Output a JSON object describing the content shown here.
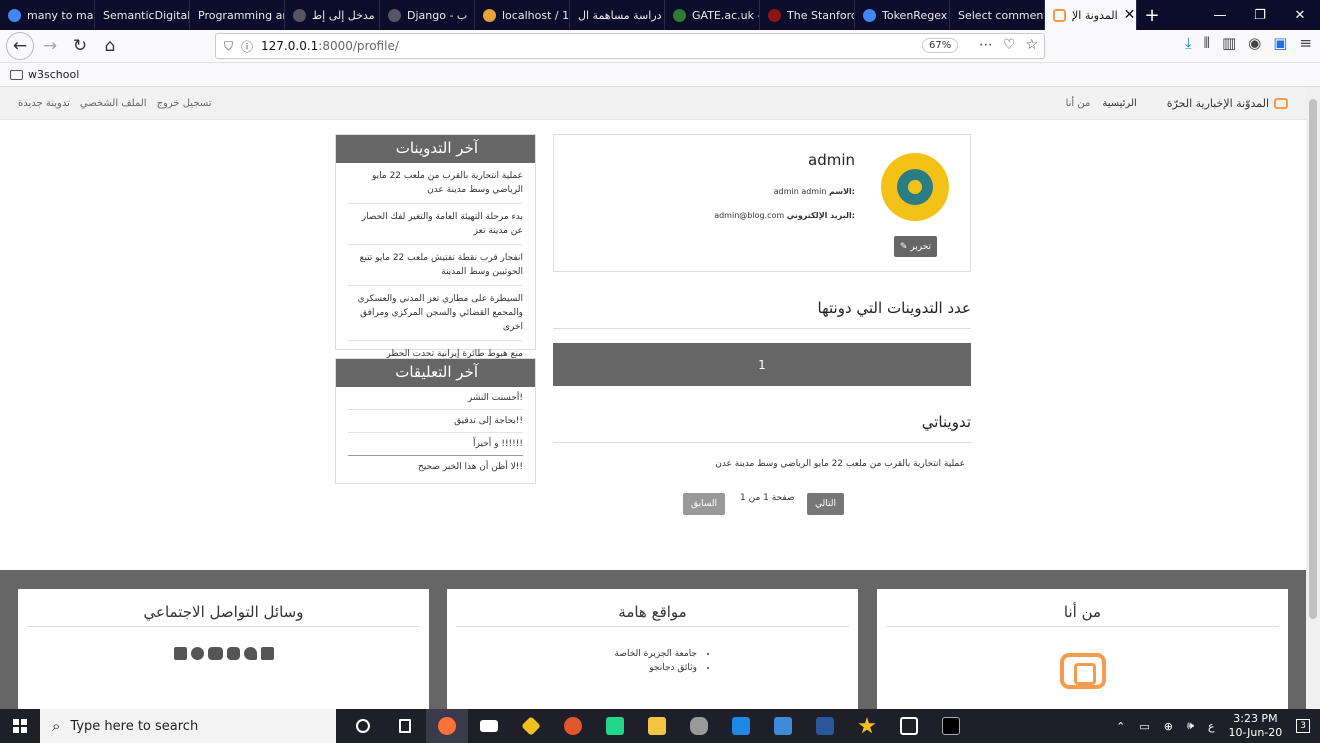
{
  "browser": {
    "tabs": [
      {
        "label": "many to ma",
        "color": "#4285f4"
      },
      {
        "label": "SemanticDigital",
        "color": "#0c0c2b"
      },
      {
        "label": "Programming an",
        "color": "#0c0c2b"
      },
      {
        "label": "مدخل إلى إط",
        "color": "#555566"
      },
      {
        "label": "Django - ب",
        "color": "#555566"
      },
      {
        "label": "localhost / 1",
        "color": "#e8a33d"
      },
      {
        "label": "دراسة مساهمة ال",
        "color": "#0c0c2b"
      },
      {
        "label": "GATE.ac.uk -",
        "color": "#2e7d32"
      },
      {
        "label": "The Stanford",
        "color": "#8c1515"
      },
      {
        "label": "TokenRegex",
        "color": "#4285f4"
      },
      {
        "label": "Select comment",
        "color": "#0c0c2b"
      }
    ],
    "active_tab": {
      "label": "المدونة الإ",
      "close": "✕"
    },
    "new_tab": "+",
    "window_controls": [
      "—",
      "❐",
      "✕"
    ],
    "url": {
      "host": "127.0.0.1",
      "rest": ":8000/profile/"
    },
    "zoom": "67%",
    "bookmark": "w3school"
  },
  "site": {
    "brand": "المدوّنة الإخبارية الحرّة",
    "nav_right": [
      "الرئيسية",
      "من أنا"
    ],
    "nav_left": [
      "تدوينة جديدة",
      "الملف الشخصي",
      "تسجيل خروج"
    ]
  },
  "profile": {
    "username": "admin",
    "name_label": "الاسم:",
    "name_value": "admin admin",
    "email_label": "البريد الإلكتروني:",
    "email_value": "admin@blog.com",
    "edit_label": "✎ تحرير"
  },
  "posts_count": {
    "heading": "عدد التدوينات التي دونتها",
    "value": "1"
  },
  "my_posts": {
    "heading": "تدويناتي",
    "items": [
      "عملية انتحارية بالقرب من ملعب 22 مايو الرياضي وسط مدينة عدن"
    ]
  },
  "pagination": {
    "next": "التالي",
    "status": "صفحة 1 من 1",
    "prev": "السابق"
  },
  "sidebar": {
    "latest_posts_title": "آخر التدوينات",
    "latest_posts": [
      "عملية انتحارية بالقرب من ملعب 22 مايو الرياضي وسط مدينة عدن",
      "بدء مرحلة التهيئة العامة والتغير لفك الحصار عن مدينة تعز",
      "انفجار قرب نقطة تفتيش ملعب 22 مايو تتبع الحوثيين وسط المدينة",
      "السيطرة على مطاري تعز المدني والعسكري والمجمع القضائي والسجن المركزي ومرافق اخرى",
      "منع هبوط طائرة إيرانية تحدت الحظر"
    ],
    "latest_comments_title": "آخر التعليقات",
    "latest_comments": [
      "أحسنت النشر!",
      "بحاجة إلى تدقيق!!",
      "و أخيراً !!!!!!",
      "لا أظن أن هذا الخبر صحيح!!"
    ]
  },
  "footer": {
    "about_title": "من أنا",
    "links_title": "مواقع هامة",
    "links": [
      "جامعة الجزيرة الخاصة",
      "وثائق دجانجو"
    ],
    "social_title": "وسائل التواصل الاجتماعي",
    "social_icons": [
      "facebook-icon",
      "twitter-icon",
      "instagram-icon",
      "youtube-icon",
      "telegram-icon",
      "linkedin-icon"
    ]
  },
  "taskbar": {
    "search_placeholder": "Type here to search",
    "time": "3:23 PM",
    "date": "10-Jun-20",
    "lang": "ع",
    "notifications": "3"
  }
}
